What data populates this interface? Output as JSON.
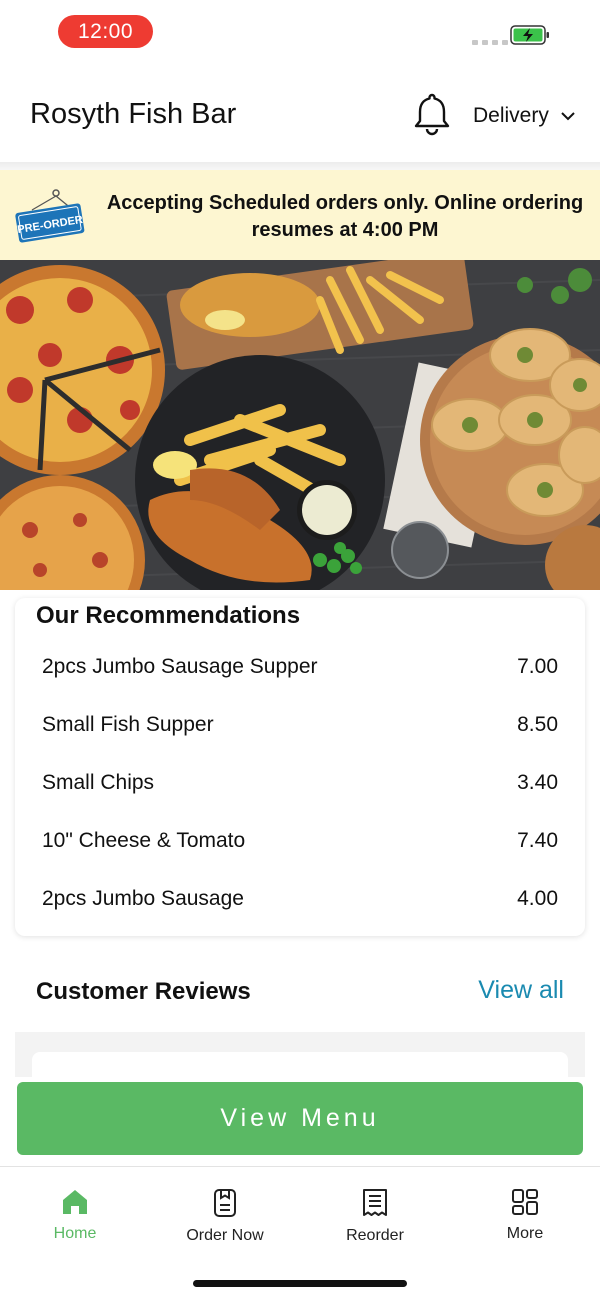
{
  "status_bar": {
    "time": "12:00"
  },
  "header": {
    "title": "Rosyth Fish Bar",
    "mode": "Delivery"
  },
  "banner": {
    "badge": "PRE-ORDER",
    "message": "Accepting Scheduled orders only. Online ordering resumes at 4:00 PM"
  },
  "recommendations": {
    "title": "Our Recommendations",
    "items": [
      {
        "name": "2pcs Jumbo Sausage Supper",
        "price": "7.00"
      },
      {
        "name": "Small Fish Supper",
        "price": "8.50"
      },
      {
        "name": "Small Chips",
        "price": "3.40"
      },
      {
        "name": "10\" Cheese & Tomato",
        "price": "7.40"
      },
      {
        "name": "2pcs Jumbo Sausage",
        "price": "4.00"
      }
    ]
  },
  "reviews": {
    "title": "Customer Reviews",
    "view_all": "View all"
  },
  "cta": {
    "label": "View Menu"
  },
  "tabbar": {
    "tabs": [
      {
        "label": "Home",
        "icon": "home-icon",
        "active": true
      },
      {
        "label": "Order Now",
        "icon": "order-icon",
        "active": false
      },
      {
        "label": "Reorder",
        "icon": "receipt-icon",
        "active": false
      },
      {
        "label": "More",
        "icon": "grid-icon",
        "active": false
      }
    ]
  },
  "colors": {
    "accent": "#5ab964",
    "link": "#1a8ab0",
    "banner_bg": "#fdf6d1",
    "time_pill": "#ee3b32"
  }
}
